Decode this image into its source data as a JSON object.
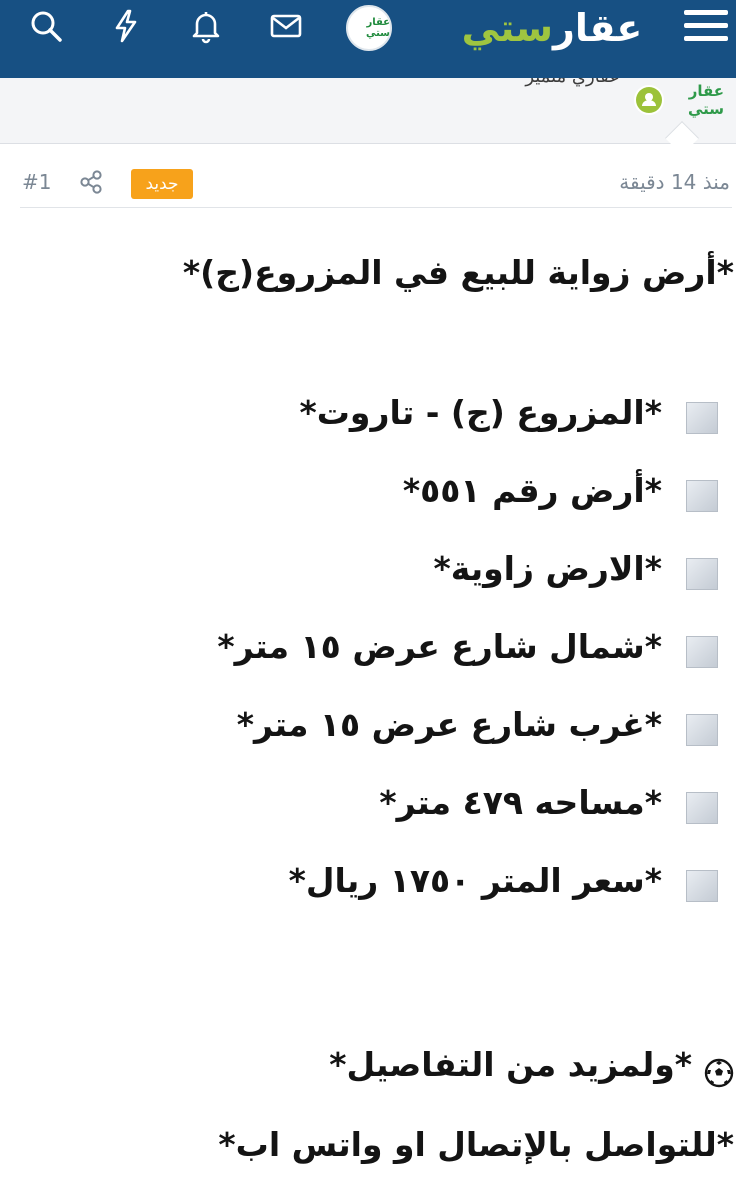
{
  "header": {
    "brand_word1": "عقار",
    "brand_word2": "ستي",
    "avatar_text": "عقار ستي",
    "icons": [
      "menu-icon",
      "search-icon",
      "lightning-icon",
      "bell-icon",
      "mail-icon"
    ],
    "background_color": "#175083",
    "accent_color": "#9fc540"
  },
  "author": {
    "name": "عقاري متميز",
    "logo_text": "عقار ستي"
  },
  "post": {
    "time_ago": "منذ 14 دقيقة",
    "badge": "جديد",
    "badge_color": "#f7a21b",
    "number": "#1",
    "title": "*أرض زواية للبيع في المزروع(ج)*",
    "items": [
      {
        "text": "*المزروع (ج) - تاروت*"
      },
      {
        "text": "*أرض رقم ٥٥١*"
      },
      {
        "text": "*الارض زاوية*"
      },
      {
        "text": "*شمال شارع عرض ١٥ متر*"
      },
      {
        "text": "*غرب شارع عرض ١٥ متر*"
      },
      {
        "text": "*مساحه ٤٧٩ متر*"
      },
      {
        "text": "*سعر المتر ١٧٥٠ ريال*"
      }
    ],
    "more_details": "*ولمزيد من التفاصيل*",
    "contact": "*للتواصل بالإتصال او واتس اب*"
  }
}
